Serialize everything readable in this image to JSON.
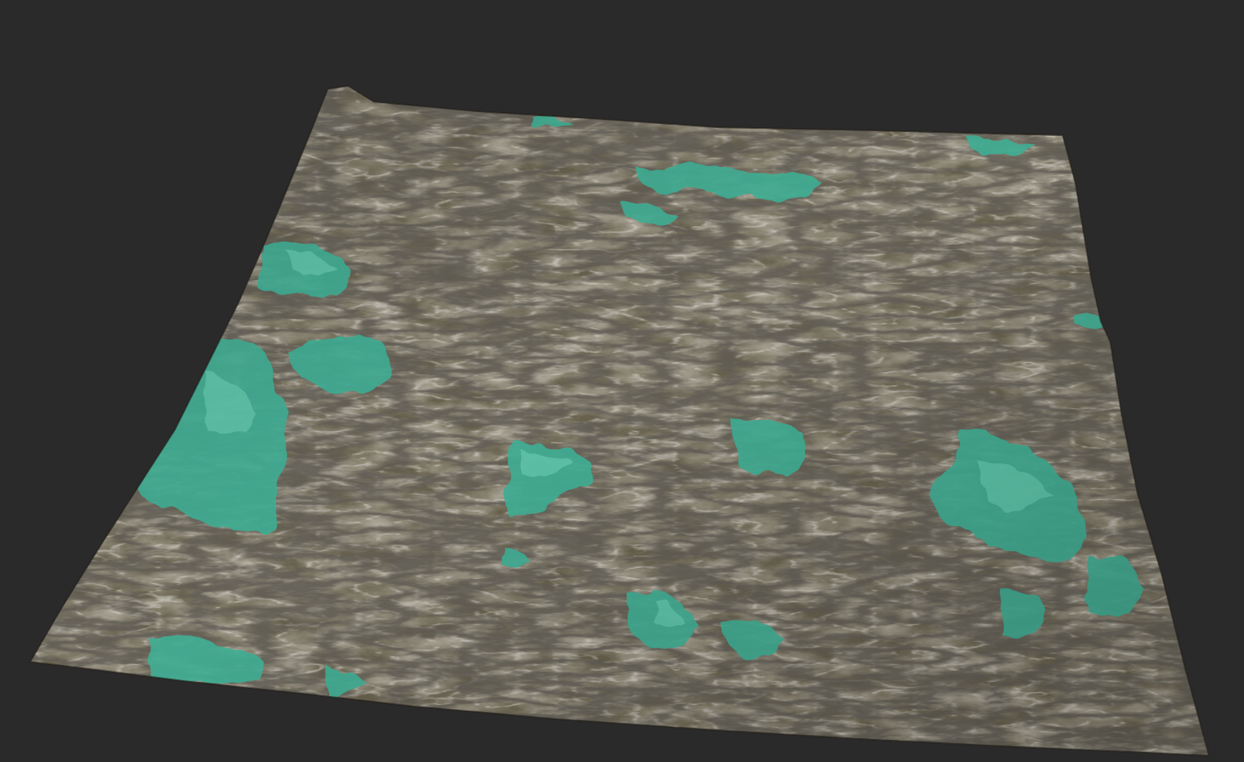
{
  "scene": {
    "background_color": "#2a2a2a",
    "object": "terrain-mesh",
    "palette": {
      "rock_base": "#6e6553",
      "rock_light": "#9a8c72",
      "rock_dark": "#2f2b24",
      "olive": "#5f5a40",
      "snow": "#c9c6bf",
      "water": "#3fae94",
      "water_light": "#5fc9ad"
    }
  }
}
